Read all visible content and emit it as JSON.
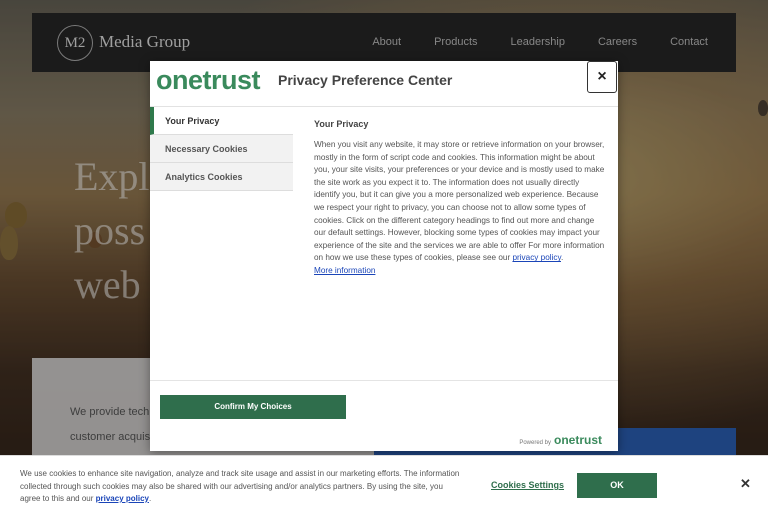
{
  "site": {
    "logo_mark": "M2",
    "logo_text": "Media Group",
    "nav": [
      "About",
      "Products",
      "Leadership",
      "Careers",
      "Contact"
    ],
    "hero_lines": [
      "Expl",
      "poss",
      "web"
    ],
    "content_lines": [
      "We provide tech",
      "customer acquis"
    ]
  },
  "modal": {
    "brand": "onetrust",
    "title": "Privacy Preference Center",
    "close": "×",
    "tabs": [
      "Your Privacy",
      "Necessary Cookies",
      "Analytics Cookies"
    ],
    "active_tab": "Your Privacy",
    "panel": {
      "heading": "Your Privacy",
      "body": "When you visit any website, it may store or retrieve information on your browser, mostly in the form of script code and cookies. This information might be about you, your site visits, your preferences or your device and is mostly used to make the site work as you expect it to. The information does not usually directly identify you, but it can give you a more personalized web experience. Because we respect your right to privacy, you can choose not to allow some types of cookies. Click on the different category headings to find out more and change our default settings. However, blocking some types of cookies may impact your experience of the site and the services we are able to offer For more information on how we use these types of cookies, please see our",
      "privacy_link": "privacy policy",
      "body_end": ".",
      "more_info": "More information"
    },
    "confirm": "Confirm My Choices",
    "powered_by": "Powered by",
    "powered_logo": "onetrust"
  },
  "banner": {
    "text": "We use cookies to enhance site navigation, analyze and track site usage and assist in our marketing efforts. The information collected through such cookies may also be shared with our advertising and/or analytics partners. By using the site, you agree to this and our",
    "privacy_link": "privacy policy",
    "text_end": ".",
    "settings": "Cookies Settings",
    "ok": "OK",
    "close": "✕"
  },
  "colors": {
    "accent_green": "#2f6e4c",
    "brand_green": "#3a8a5c",
    "header_dark": "#262626",
    "link_blue": "#1a45b8"
  }
}
